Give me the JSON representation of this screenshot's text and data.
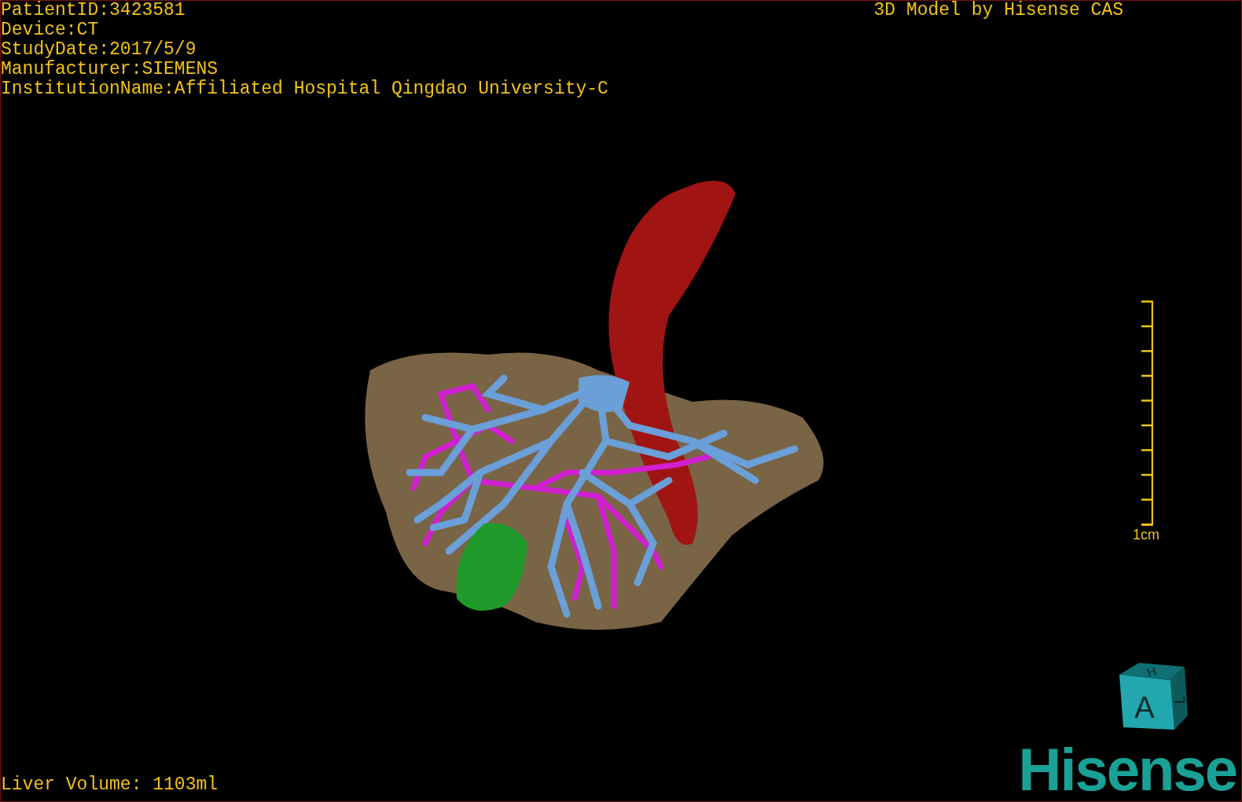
{
  "patient_info": [
    "PatientID:3423581",
    "Device:CT",
    "StudyDate:2017/5/9",
    "Manufacturer:SIEMENS",
    "InstitutionName:Affiliated Hospital Qingdao University-C"
  ],
  "header": "3D Model by Hisense CAS",
  "scale_bar": {
    "label": "1cm"
  },
  "footer": "Liver Volume: 1103ml",
  "orientation_cube": {
    "front": "A",
    "top": "H",
    "side": "L"
  },
  "logo": "Hisense"
}
